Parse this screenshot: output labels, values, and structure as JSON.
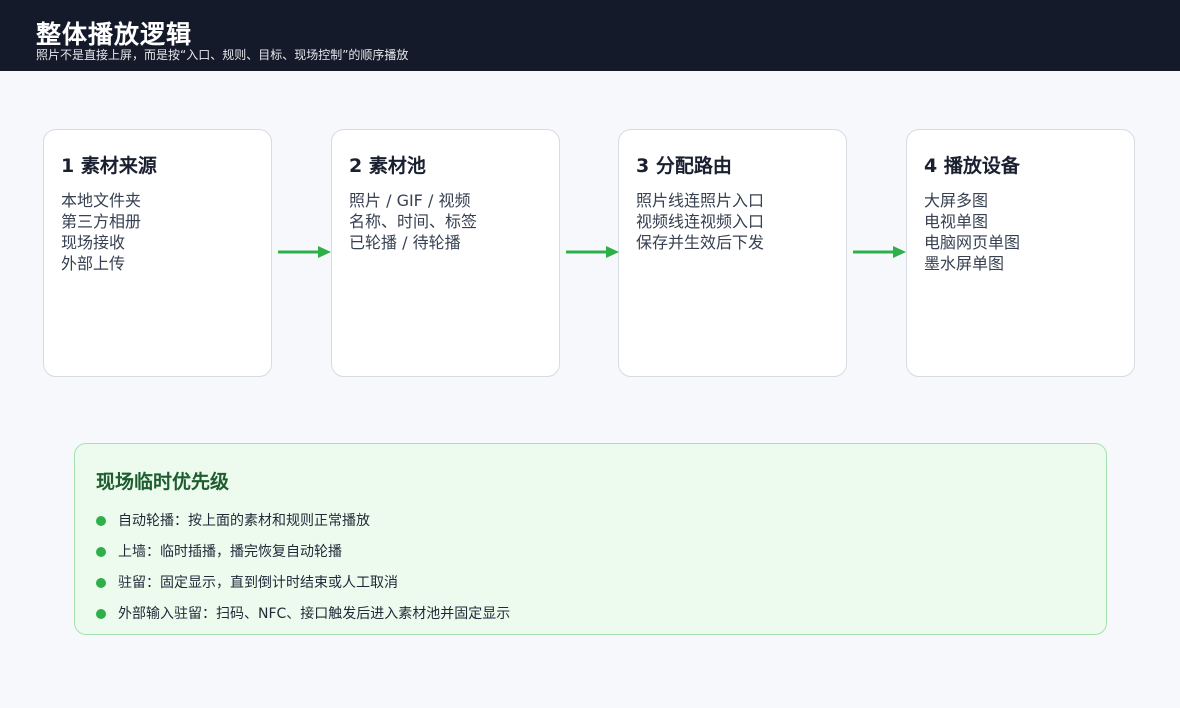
{
  "header": {
    "title": "整体播放逻辑",
    "subtitle": "照片不是直接上屏，而是按“入口、规则、目标、现场控制”的顺序播放"
  },
  "flow": [
    {
      "title": "1 素材来源",
      "lines": [
        "本地文件夹",
        "第三方相册",
        "现场接收",
        "外部上传"
      ]
    },
    {
      "title": "2 素材池",
      "lines": [
        "照片 / GIF / 视频",
        "名称、时间、标签",
        "已轮播 / 待轮播"
      ]
    },
    {
      "title": "3 分配路由",
      "lines": [
        "照片线连照片入口",
        "视频线连视频入口",
        "保存并生效后下发"
      ]
    },
    {
      "title": "4 播放设备",
      "lines": [
        "大屏多图",
        "电视单图",
        "电脑网页单图",
        "墨水屏单图"
      ]
    }
  ],
  "priority": {
    "title": "现场临时优先级",
    "items": [
      "自动轮播：按上面的素材和规则正常播放",
      "上墙：临时插播，播完恢复自动轮播",
      "驻留：固定显示，直到倒计时结束或人工取消",
      "外部输入驻留：扫码、NFC、接口触发后进入素材池并固定显示"
    ]
  },
  "colors": {
    "header_bg": "#141a2a",
    "arrow": "#2db049",
    "bullet": "#2db049",
    "priority_bg": "#edfbef",
    "priority_border": "#a5e2b0",
    "priority_title": "#1d5d2e"
  },
  "icons": [
    "arrow-right-icon",
    "bullet-dot-icon"
  ]
}
